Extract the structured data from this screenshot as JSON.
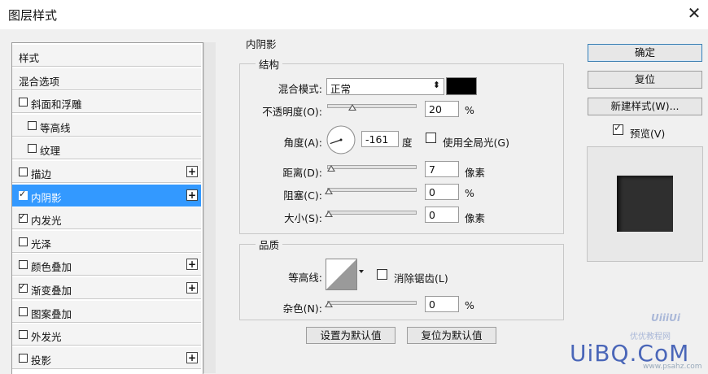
{
  "window": {
    "title": "图层样式",
    "close_glyph": "✕"
  },
  "left_panel": {
    "items": [
      {
        "label": "样式",
        "checkbox": false,
        "checked": false,
        "plus": false,
        "selected": false
      },
      {
        "label": "混合选项",
        "checkbox": false,
        "checked": false,
        "plus": false,
        "selected": false
      },
      {
        "label": "斜面和浮雕",
        "checkbox": true,
        "checked": false,
        "plus": false,
        "selected": false
      },
      {
        "label": "等高线",
        "checkbox": true,
        "checked": false,
        "plus": false,
        "selected": false,
        "indent": true
      },
      {
        "label": "纹理",
        "checkbox": true,
        "checked": false,
        "plus": false,
        "selected": false,
        "indent": true
      },
      {
        "label": "描边",
        "checkbox": true,
        "checked": false,
        "plus": true,
        "selected": false
      },
      {
        "label": "内阴影",
        "checkbox": true,
        "checked": true,
        "plus": true,
        "selected": true
      },
      {
        "label": "内发光",
        "checkbox": true,
        "checked": true,
        "plus": false,
        "selected": false
      },
      {
        "label": "光泽",
        "checkbox": true,
        "checked": false,
        "plus": false,
        "selected": false
      },
      {
        "label": "颜色叠加",
        "checkbox": true,
        "checked": false,
        "plus": true,
        "selected": false
      },
      {
        "label": "渐变叠加",
        "checkbox": true,
        "checked": true,
        "plus": true,
        "selected": false
      },
      {
        "label": "图案叠加",
        "checkbox": true,
        "checked": false,
        "plus": false,
        "selected": false
      },
      {
        "label": "外发光",
        "checkbox": true,
        "checked": false,
        "plus": false,
        "selected": false
      },
      {
        "label": "投影",
        "checkbox": true,
        "checked": false,
        "plus": true,
        "selected": false
      }
    ],
    "plus_glyph": "+"
  },
  "inner_shadow": {
    "section_title": "内阴影",
    "structure": {
      "legend": "结构",
      "blend_mode_label": "混合模式:",
      "blend_mode_value": "正常",
      "dropdown_glyph": "⬍",
      "color": "#000000",
      "opacity_label": "不透明度(O):",
      "opacity_value": "20",
      "opacity_unit": "%",
      "opacity_fraction": 0.2,
      "angle_label": "角度(A):",
      "angle_value": "-161",
      "angle_unit": "度",
      "global_light_label": "使用全局光(G)",
      "global_light_checked": false,
      "distance_label": "距离(D):",
      "distance_value": "7",
      "distance_unit": "像素",
      "distance_fraction": 0.03,
      "choke_label": "阻塞(C):",
      "choke_value": "0",
      "choke_unit": "%",
      "choke_fraction": 0,
      "size_label": "大小(S):",
      "size_value": "0",
      "size_unit": "像素",
      "size_fraction": 0
    },
    "quality": {
      "legend": "品质",
      "contour_label": "等高线:",
      "anti_alias_label": "消除锯齿(L)",
      "anti_alias_checked": false,
      "noise_label": "杂色(N):",
      "noise_value": "0",
      "noise_unit": "%",
      "noise_fraction": 0
    },
    "set_default_button": "设置为默认值",
    "reset_default_button": "复位为默认值"
  },
  "right_panel": {
    "ok_button": "确定",
    "reset_button": "复位",
    "new_style_button": "新建样式(W)...",
    "preview_label": "预览(V)",
    "preview_checked": true
  },
  "watermark": {
    "top": "UiiiUi",
    "middle": "优优教程网",
    "brand": "UiBQ.CoM",
    "url": "www.psahz.com"
  },
  "colors": {
    "selection": "#3399ff",
    "preview_square": "#2f2f2f",
    "preview_bg": "#e8e8e8"
  }
}
